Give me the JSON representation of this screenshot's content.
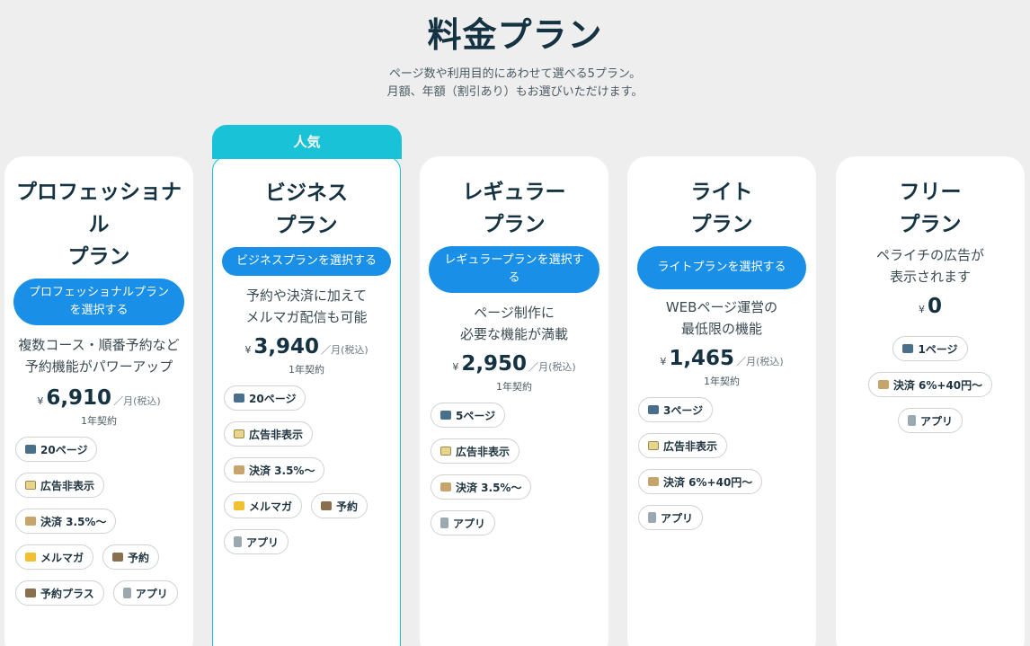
{
  "header": {
    "title": "料金プラン",
    "subtitle_line1": "ページ数や利用目的にあわせて選べる5プラン。",
    "subtitle_line2": "月額、年額（割引あり）もお選びいただけます。"
  },
  "badge": "人気",
  "plans": [
    {
      "name_line1": "プロフェッショナ",
      "name_line2": "ル",
      "name_line3": "プラン",
      "button": "プロフェッショナルプランを選択する",
      "desc": "複数コース・順番予約など予約機能がパワーアップ",
      "yen": "¥",
      "price": "6,910",
      "unit": "／月(税込)",
      "contract": "1年契約",
      "features": [
        {
          "icon": "page-icon",
          "label": "20ページ"
        },
        {
          "icon": "ad-icon",
          "label": "広告非表示"
        },
        {
          "icon": "cart-icon",
          "label": "決済 3.5%〜"
        },
        {
          "icon": "mail-icon",
          "label": "メルマガ"
        },
        {
          "icon": "calendar-icon",
          "label": "予約"
        },
        {
          "icon": "calendar-icon",
          "label": "予約プラス"
        },
        {
          "icon": "app-icon",
          "label": "アプリ"
        }
      ]
    },
    {
      "name_line1": "ビジネス",
      "name_line2": "プラン",
      "button": "ビジネスプランを選択する",
      "desc_line1": "予約や決済に加えて",
      "desc_line2": "メルマガ配信も可能",
      "yen": "¥",
      "price": "3,940",
      "unit": "／月(税込)",
      "contract": "1年契約",
      "features": [
        {
          "icon": "page-icon",
          "label": "20ページ"
        },
        {
          "icon": "ad-icon",
          "label": "広告非表示"
        },
        {
          "icon": "cart-icon",
          "label": "決済 3.5%〜"
        },
        {
          "icon": "mail-icon",
          "label": "メルマガ"
        },
        {
          "icon": "calendar-icon",
          "label": "予約"
        },
        {
          "icon": "app-icon",
          "label": "アプリ"
        }
      ]
    },
    {
      "name_line1": "レギュラー",
      "name_line2": "プラン",
      "button": "レギュラープランを選択する",
      "desc_line1": "ページ制作に",
      "desc_line2": "必要な機能が満載",
      "yen": "¥",
      "price": "2,950",
      "unit": "／月(税込)",
      "contract": "1年契約",
      "features": [
        {
          "icon": "page-icon",
          "label": "5ページ"
        },
        {
          "icon": "ad-icon",
          "label": "広告非表示"
        },
        {
          "icon": "cart-icon",
          "label": "決済 3.5%〜"
        },
        {
          "icon": "app-icon",
          "label": "アプリ"
        }
      ]
    },
    {
      "name_line1": "ライト",
      "name_line2": "プラン",
      "button": "ライトプランを選択する",
      "desc_line1": "WEBページ運営の",
      "desc_line2": "最低限の機能",
      "yen": "¥",
      "price": "1,465",
      "unit": "／月(税込)",
      "contract": "1年契約",
      "features": [
        {
          "icon": "page-icon",
          "label": "3ページ"
        },
        {
          "icon": "ad-icon",
          "label": "広告非表示"
        },
        {
          "icon": "cart-icon",
          "label": "決済 6%+40円〜"
        },
        {
          "icon": "app-icon",
          "label": "アプリ"
        }
      ]
    },
    {
      "name_line1": "フリー",
      "name_line2": "プラン",
      "desc_line1": "ペライチの広告が",
      "desc_line2": "表示されます",
      "yen": "¥",
      "price": "0",
      "features": [
        {
          "icon": "page-icon",
          "label": "1ページ"
        },
        {
          "icon": "cart-icon",
          "label": "決済 6%+40円〜"
        },
        {
          "icon": "app-icon",
          "label": "アプリ"
        }
      ]
    }
  ]
}
